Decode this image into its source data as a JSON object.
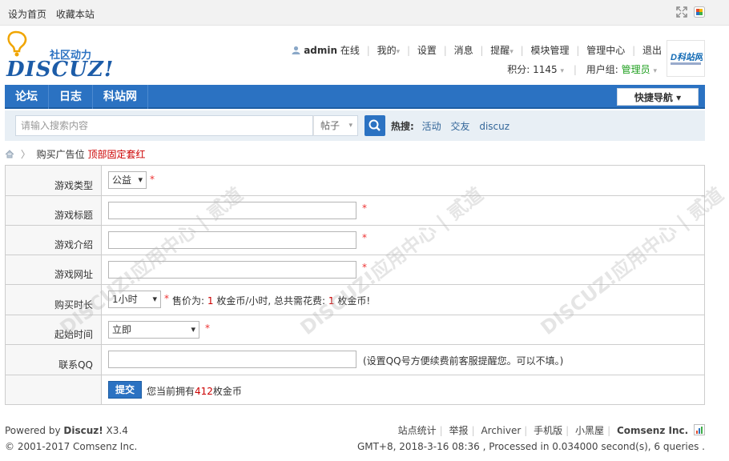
{
  "topbar": {
    "set_home": "设为首页",
    "bookmark": "收藏本站"
  },
  "logo": {
    "community": "社区动力",
    "brand": "DISCUZ!"
  },
  "user": {
    "name": "admin",
    "status": "在线",
    "links": [
      "我的",
      "设置",
      "消息",
      "提醒",
      "模块管理",
      "管理中心",
      "退出"
    ],
    "points_label": "积分: ",
    "points": "1145",
    "group_label": "用户组: ",
    "group": "管理员"
  },
  "nav": {
    "items": [
      "论坛",
      "日志",
      "科站网"
    ],
    "quick_nav": "快捷导航 ▾"
  },
  "search": {
    "placeholder": "请输入搜索内容",
    "type": "帖子",
    "hot_label": "热搜:",
    "hot_terms": [
      "活动",
      "交友",
      "discuz"
    ]
  },
  "breadcrumb": {
    "home_icon": "home-icon",
    "item": "购买广告位",
    "current": "顶部固定套红"
  },
  "form": {
    "game_type_label": "游戏类型",
    "game_type_value": "公益",
    "game_title_label": "游戏标题",
    "game_intro_label": "游戏介绍",
    "game_url_label": "游戏网址",
    "duration_label": "购买时长",
    "duration_value": "1小时",
    "price_prefix": "售价为:",
    "price_rate": "1",
    "price_mid": "枚金币/小时, 总共需花费:",
    "price_total": "1",
    "price_suffix": "枚金币!",
    "start_label": "起始时间",
    "start_value": "立即",
    "qq_label": "联系QQ",
    "qq_hint": "(设置QQ号方便续费前客服提醒您。可以不填。)",
    "submit_label": "提交",
    "balance_prefix": "您当前拥有",
    "balance": "412",
    "balance_suffix": "枚金币",
    "required_mark": "*"
  },
  "footer": {
    "powered_prefix": "Powered by ",
    "powered_brand": "Discuz!",
    "version": " X3.4",
    "copyright": "© 2001-2017 Comsenz Inc.",
    "links": [
      "站点统计",
      "举报",
      "Archiver",
      "手机版",
      "小黑屋"
    ],
    "company": "Comsenz Inc.",
    "stats": "GMT+8, 2018-3-16 08:36 , Processed in 0.034000 second(s), 6 queries ."
  },
  "colors": {
    "nav_blue": "#2b72c2",
    "required_red": "#e33",
    "group_green": "#1e9f1e"
  }
}
